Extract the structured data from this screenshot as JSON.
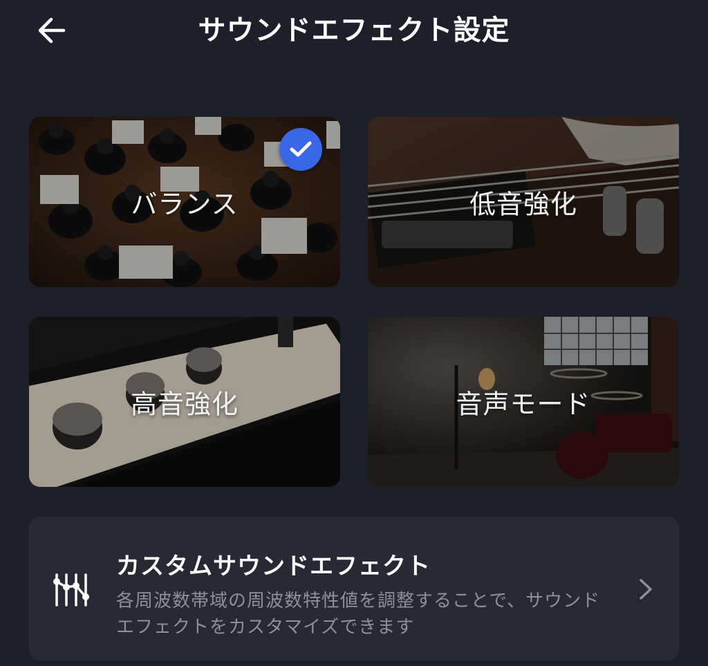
{
  "header": {
    "title": "サウンドエフェクト設定",
    "back_icon": "arrow-left-icon"
  },
  "presets": [
    {
      "label": "バランス",
      "selected": true,
      "image": "orchestra-photo"
    },
    {
      "label": "低音強化",
      "selected": false,
      "image": "bass-guitar-photo"
    },
    {
      "label": "高音強化",
      "selected": false,
      "image": "amplifier-knobs-photo"
    },
    {
      "label": "音声モード",
      "selected": false,
      "image": "stage-microphone-photo"
    }
  ],
  "custom": {
    "title": "カスタムサウンドエフェクト",
    "description": "各周波数帯域の周波数特性値を調整することで、サウンドエフェクトをカスタマイズできます",
    "icon": "equalizer-sliders-icon",
    "chevron_icon": "chevron-right-icon"
  },
  "colors": {
    "background": "#1d1f2a",
    "panel": "#272935",
    "accent": "#3a66e8",
    "secondary_text": "#8d8f9b"
  }
}
